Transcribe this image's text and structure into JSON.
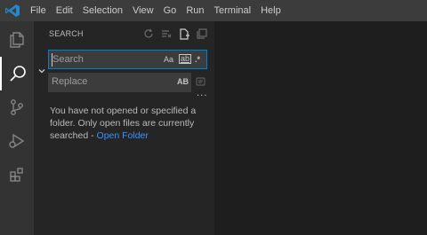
{
  "titlebar": {
    "menu": [
      "File",
      "Edit",
      "Selection",
      "View",
      "Go",
      "Run",
      "Terminal",
      "Help"
    ]
  },
  "activity_bar": {
    "items": [
      "explorer-icon",
      "search-icon",
      "source-control-icon",
      "run-debug-icon",
      "extensions-icon"
    ],
    "active": "search-icon"
  },
  "search_panel": {
    "title": "SEARCH",
    "search": {
      "value": "",
      "placeholder": "Search",
      "options": [
        "Aa",
        "ab",
        ".*"
      ]
    },
    "replace": {
      "value": "",
      "placeholder": "Replace",
      "preserve_case": "AB"
    },
    "message": "You have not opened or specified a folder. Only open files are currently searched - ",
    "link": "Open Folder"
  },
  "colors": {
    "accent": "#007fd4",
    "link": "#3794ff",
    "titlebar": "#3c3c3c",
    "activity_bar": "#333333",
    "sidebar": "#252526",
    "editor": "#1e1e1e"
  }
}
